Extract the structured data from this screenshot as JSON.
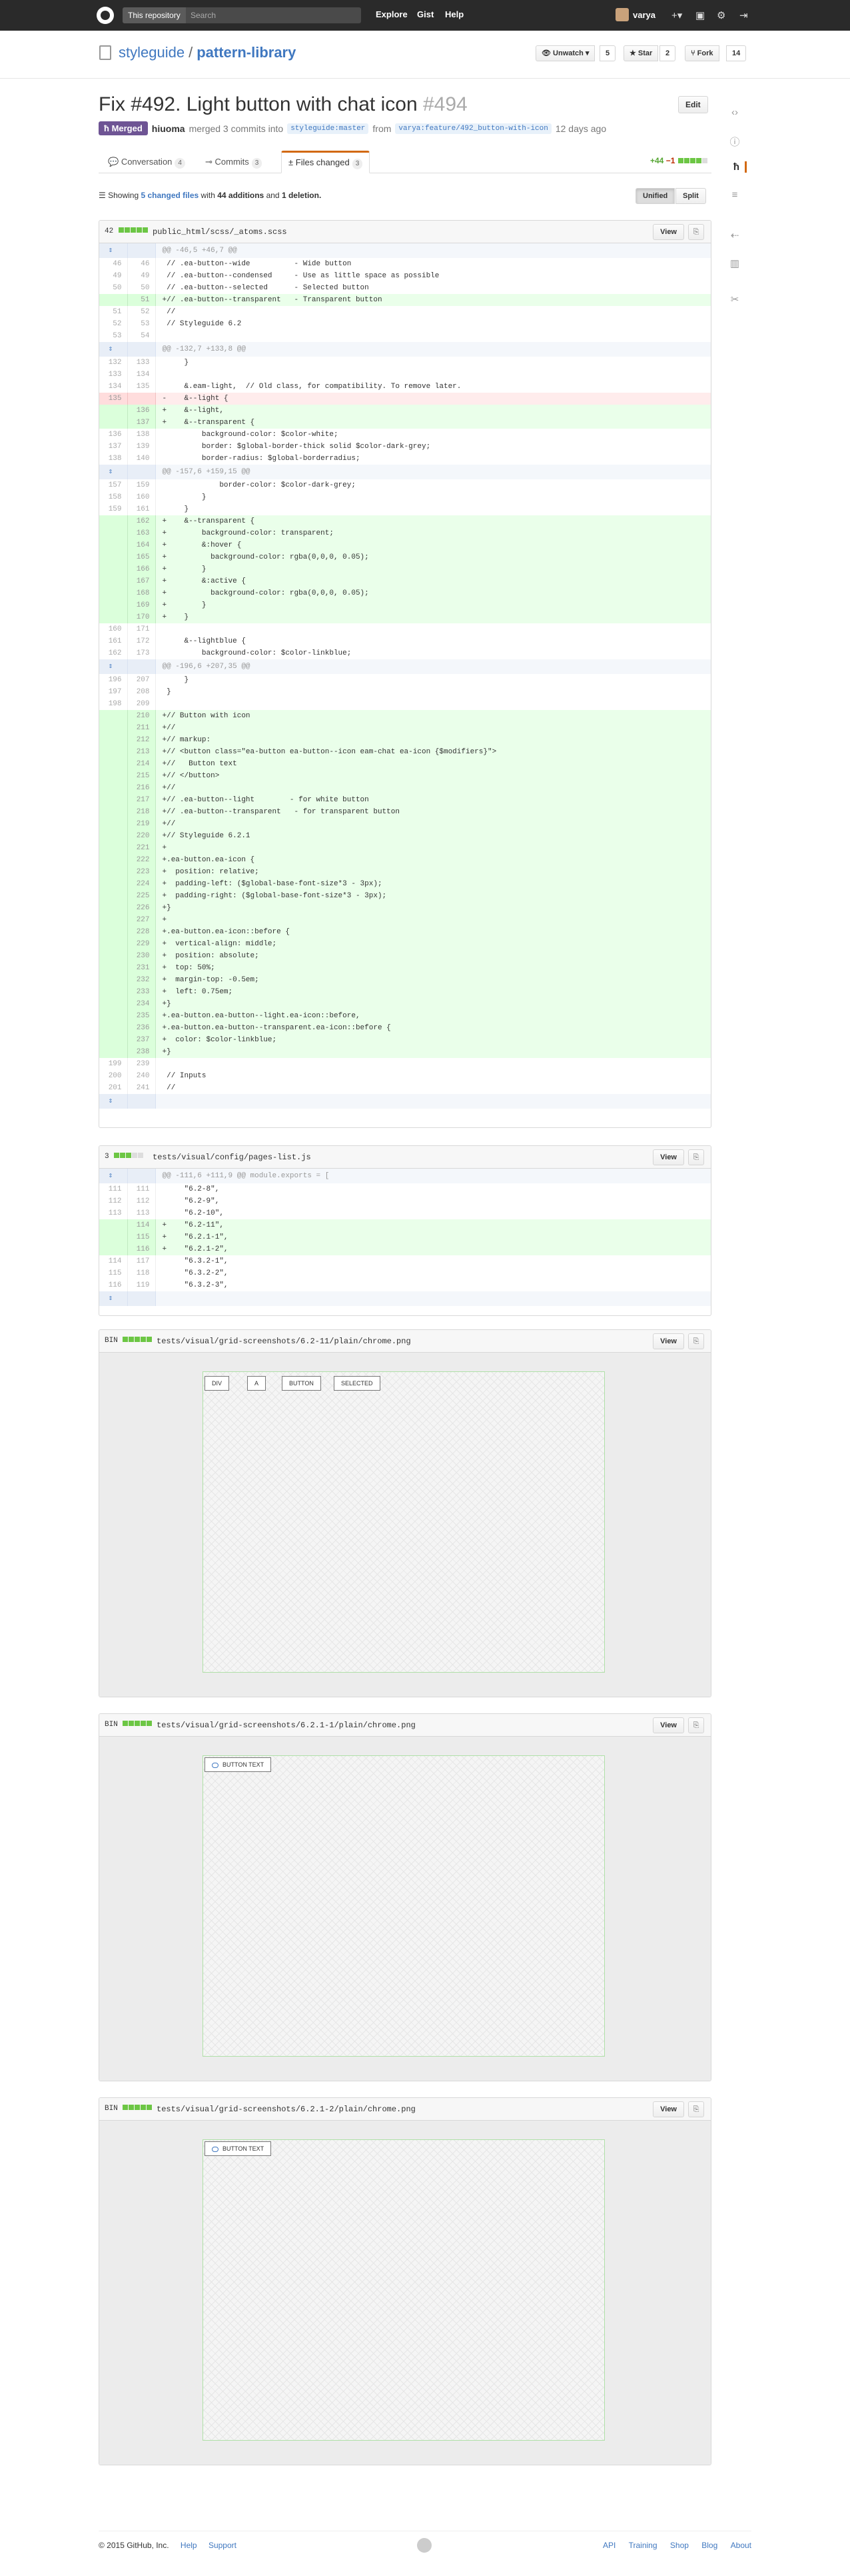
{
  "header": {
    "search_scope": "This repository",
    "search_placeholder": "Search",
    "nav": [
      "Explore",
      "Gist",
      "Help"
    ],
    "username": "varya"
  },
  "repo": {
    "owner": "styleguide",
    "name": "pattern-library",
    "unwatch_label": "Unwatch",
    "watch_count": "5",
    "star_label": "Star",
    "star_count": "2",
    "fork_label": "Fork",
    "fork_count": "14"
  },
  "pr": {
    "title": "Fix #492. Light button with chat icon",
    "number": "#494",
    "edit_label": "Edit",
    "status": "Merged",
    "author": "hiuoma",
    "merge_text": "merged 3 commits into",
    "base_branch": "styleguide:master",
    "from_text": "from",
    "head_branch": "varya:feature/492_button-with-icon",
    "time_ago": "12 days ago"
  },
  "tabs": [
    {
      "label": "Conversation",
      "count": "4"
    },
    {
      "label": "Commits",
      "count": "3"
    },
    {
      "label": "Files changed",
      "count": "3"
    }
  ],
  "diffstat": {
    "additions": "+44",
    "deletions": "−1"
  },
  "toc": {
    "prefix": "Showing",
    "files_link": "5 changed files",
    "with": "with",
    "additions": "44 additions",
    "and": "and",
    "deletions": "1 deletion.",
    "unified": "Unified",
    "split": "Split"
  },
  "files": [
    {
      "stat": "42",
      "path": "public_html/scss/_atoms.scss",
      "view": "View",
      "lines": [
        {
          "t": "hunk",
          "o": "",
          "n": "",
          "x": "@@ -46,5 +46,7 @@"
        },
        {
          "t": "ctx",
          "o": "46",
          "n": "46",
          "x": " // .ea-button--wide          - Wide button"
        },
        {
          "t": "ctx",
          "o": "49",
          "n": "49",
          "x": " // .ea-button--condensed     - Use as little space as possible"
        },
        {
          "t": "ctx",
          "o": "50",
          "n": "50",
          "x": " // .ea-button--selected      - Selected button"
        },
        {
          "t": "add",
          "o": "",
          "n": "51",
          "x": "+// .ea-button--transparent   - Transparent button"
        },
        {
          "t": "ctx",
          "o": "51",
          "n": "52",
          "x": " //"
        },
        {
          "t": "ctx",
          "o": "52",
          "n": "53",
          "x": " // Styleguide 6.2"
        },
        {
          "t": "ctx",
          "o": "53",
          "n": "54",
          "x": " "
        },
        {
          "t": "hunk",
          "o": "",
          "n": "",
          "x": "@@ -132,7 +133,8 @@"
        },
        {
          "t": "ctx",
          "o": "132",
          "n": "133",
          "x": "     }"
        },
        {
          "t": "ctx",
          "o": "133",
          "n": "134",
          "x": " "
        },
        {
          "t": "ctx",
          "o": "134",
          "n": "135",
          "x": "     &.eam-light,  // Old class, for compatibility. To remove later."
        },
        {
          "t": "del",
          "o": "135",
          "n": "",
          "x": "-    &--light {"
        },
        {
          "t": "add",
          "o": "",
          "n": "136",
          "x": "+    &--light,"
        },
        {
          "t": "add",
          "o": "",
          "n": "137",
          "x": "+    &--transparent {"
        },
        {
          "t": "ctx",
          "o": "136",
          "n": "138",
          "x": "         background-color: $color-white;"
        },
        {
          "t": "ctx",
          "o": "137",
          "n": "139",
          "x": "         border: $global-border-thick solid $color-dark-grey;"
        },
        {
          "t": "ctx",
          "o": "138",
          "n": "140",
          "x": "         border-radius: $global-borderradius;"
        },
        {
          "t": "hunk",
          "o": "",
          "n": "",
          "x": "@@ -157,6 +159,15 @@"
        },
        {
          "t": "ctx",
          "o": "157",
          "n": "159",
          "x": "             border-color: $color-dark-grey;"
        },
        {
          "t": "ctx",
          "o": "158",
          "n": "160",
          "x": "         }"
        },
        {
          "t": "ctx",
          "o": "159",
          "n": "161",
          "x": "     }"
        },
        {
          "t": "add",
          "o": "",
          "n": "162",
          "x": "+    &--transparent {"
        },
        {
          "t": "add",
          "o": "",
          "n": "163",
          "x": "+        background-color: transparent;"
        },
        {
          "t": "add",
          "o": "",
          "n": "164",
          "x": "+        &:hover {"
        },
        {
          "t": "add",
          "o": "",
          "n": "165",
          "x": "+          background-color: rgba(0,0,0, 0.05);"
        },
        {
          "t": "add",
          "o": "",
          "n": "166",
          "x": "+        }"
        },
        {
          "t": "add",
          "o": "",
          "n": "167",
          "x": "+        &:active {"
        },
        {
          "t": "add",
          "o": "",
          "n": "168",
          "x": "+          background-color: rgba(0,0,0, 0.05);"
        },
        {
          "t": "add",
          "o": "",
          "n": "169",
          "x": "+        }"
        },
        {
          "t": "add",
          "o": "",
          "n": "170",
          "x": "+    }"
        },
        {
          "t": "ctx",
          "o": "160",
          "n": "171",
          "x": " "
        },
        {
          "t": "ctx",
          "o": "161",
          "n": "172",
          "x": "     &--lightblue {"
        },
        {
          "t": "ctx",
          "o": "162",
          "n": "173",
          "x": "         background-color: $color-linkblue;"
        },
        {
          "t": "hunk",
          "o": "",
          "n": "",
          "x": "@@ -196,6 +207,35 @@"
        },
        {
          "t": "ctx",
          "o": "196",
          "n": "207",
          "x": "     }"
        },
        {
          "t": "ctx",
          "o": "197",
          "n": "208",
          "x": " }"
        },
        {
          "t": "ctx",
          "o": "198",
          "n": "209",
          "x": " "
        },
        {
          "t": "add",
          "o": "",
          "n": "210",
          "x": "+// Button with icon"
        },
        {
          "t": "add",
          "o": "",
          "n": "211",
          "x": "+//"
        },
        {
          "t": "add",
          "o": "",
          "n": "212",
          "x": "+// markup:"
        },
        {
          "t": "add",
          "o": "",
          "n": "213",
          "x": "+// <button class=\"ea-button ea-button--icon eam-chat ea-icon {$modifiers}\">"
        },
        {
          "t": "add",
          "o": "",
          "n": "214",
          "x": "+//   Button text"
        },
        {
          "t": "add",
          "o": "",
          "n": "215",
          "x": "+// </button>"
        },
        {
          "t": "add",
          "o": "",
          "n": "216",
          "x": "+//"
        },
        {
          "t": "add",
          "o": "",
          "n": "217",
          "x": "+// .ea-button--light        - for white button"
        },
        {
          "t": "add",
          "o": "",
          "n": "218",
          "x": "+// .ea-button--transparent   - for transparent button"
        },
        {
          "t": "add",
          "o": "",
          "n": "219",
          "x": "+//"
        },
        {
          "t": "add",
          "o": "",
          "n": "220",
          "x": "+// Styleguide 6.2.1"
        },
        {
          "t": "add",
          "o": "",
          "n": "221",
          "x": "+"
        },
        {
          "t": "add",
          "o": "",
          "n": "222",
          "x": "+.ea-button.ea-icon {"
        },
        {
          "t": "add",
          "o": "",
          "n": "223",
          "x": "+  position: relative;"
        },
        {
          "t": "add",
          "o": "",
          "n": "224",
          "x": "+  padding-left: ($global-base-font-size*3 - 3px);"
        },
        {
          "t": "add",
          "o": "",
          "n": "225",
          "x": "+  padding-right: ($global-base-font-size*3 - 3px);"
        },
        {
          "t": "add",
          "o": "",
          "n": "226",
          "x": "+}"
        },
        {
          "t": "add",
          "o": "",
          "n": "227",
          "x": "+"
        },
        {
          "t": "add",
          "o": "",
          "n": "228",
          "x": "+.ea-button.ea-icon::before {"
        },
        {
          "t": "add",
          "o": "",
          "n": "229",
          "x": "+  vertical-align: middle;"
        },
        {
          "t": "add",
          "o": "",
          "n": "230",
          "x": "+  position: absolute;"
        },
        {
          "t": "add",
          "o": "",
          "n": "231",
          "x": "+  top: 50%;"
        },
        {
          "t": "add",
          "o": "",
          "n": "232",
          "x": "+  margin-top: -0.5em;"
        },
        {
          "t": "add",
          "o": "",
          "n": "233",
          "x": "+  left: 0.75em;"
        },
        {
          "t": "add",
          "o": "",
          "n": "234",
          "x": "+}"
        },
        {
          "t": "add",
          "o": "",
          "n": "235",
          "x": "+.ea-button.ea-button--light.ea-icon::before,"
        },
        {
          "t": "add",
          "o": "",
          "n": "236",
          "x": "+.ea-button.ea-button--transparent.ea-icon::before {"
        },
        {
          "t": "add",
          "o": "",
          "n": "237",
          "x": "+  color: $color-linkblue;"
        },
        {
          "t": "add",
          "o": "",
          "n": "238",
          "x": "+}"
        },
        {
          "t": "ctx",
          "o": "199",
          "n": "239",
          "x": " "
        },
        {
          "t": "ctx",
          "o": "200",
          "n": "240",
          "x": " // Inputs"
        },
        {
          "t": "ctx",
          "o": "201",
          "n": "241",
          "x": " //"
        },
        {
          "t": "hunk",
          "o": "",
          "n": "",
          "x": ""
        }
      ]
    },
    {
      "stat": "3",
      "path": "tests/visual/config/pages-list.js",
      "view": "View",
      "lines": [
        {
          "t": "hunk",
          "o": "",
          "n": "",
          "x": "@@ -111,6 +111,9 @@ module.exports = ["
        },
        {
          "t": "ctx",
          "o": "111",
          "n": "111",
          "x": "     \"6.2-8\","
        },
        {
          "t": "ctx",
          "o": "112",
          "n": "112",
          "x": "     \"6.2-9\","
        },
        {
          "t": "ctx",
          "o": "113",
          "n": "113",
          "x": "     \"6.2-10\","
        },
        {
          "t": "add",
          "o": "",
          "n": "114",
          "x": "+    \"6.2-11\","
        },
        {
          "t": "add",
          "o": "",
          "n": "115",
          "x": "+    \"6.2.1-1\","
        },
        {
          "t": "add",
          "o": "",
          "n": "116",
          "x": "+    \"6.2.1-2\","
        },
        {
          "t": "ctx",
          "o": "114",
          "n": "117",
          "x": "     \"6.3.2-1\","
        },
        {
          "t": "ctx",
          "o": "115",
          "n": "118",
          "x": "     \"6.3.2-2\","
        },
        {
          "t": "ctx",
          "o": "116",
          "n": "119",
          "x": "     \"6.3.2-3\","
        },
        {
          "t": "hunk",
          "o": "",
          "n": "",
          "x": ""
        }
      ]
    }
  ],
  "binaries": [
    {
      "stat": "BIN",
      "path": "tests/visual/grid-screenshots/6.2-11/plain/chrome.png",
      "view": "View",
      "buttons": [
        "DIV",
        "A",
        "BUTTON",
        "SELECTED"
      ]
    },
    {
      "stat": "BIN",
      "path": "tests/visual/grid-screenshots/6.2.1-1/plain/chrome.png",
      "view": "View",
      "buttons": [
        "BUTTON TEXT"
      ]
    },
    {
      "stat": "BIN",
      "path": "tests/visual/grid-screenshots/6.2.1-2/plain/chrome.png",
      "view": "View",
      "buttons": [
        "BUTTON TEXT"
      ]
    }
  ],
  "footer": {
    "copyright": "© 2015 GitHub, Inc.",
    "left_links": [
      "Help",
      "Support"
    ],
    "right_links": [
      "API",
      "Training",
      "Shop",
      "Blog",
      "About"
    ]
  }
}
